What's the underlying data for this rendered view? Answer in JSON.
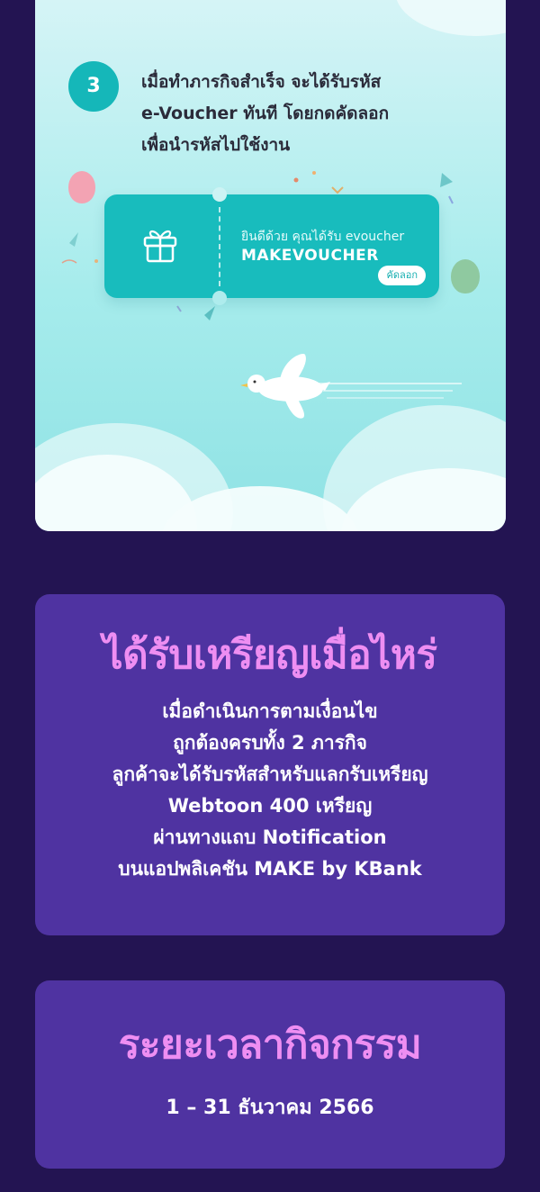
{
  "step": {
    "number": "3",
    "lines": [
      "เมื่อทำภารกิจสำเร็จ จะได้รับรหัส",
      "e-Voucher ทันที โดยกดคัดลอก",
      "เพื่อนำรหัสไปใช้งาน"
    ]
  },
  "voucher": {
    "message": "ยินดีด้วย คุณได้รับ evoucher",
    "code": "MAKEVOUCHER",
    "copy_label": "คัดลอก",
    "icon": "gift-icon"
  },
  "reward": {
    "title": "ได้รับเหรียญเมื่อไหร่",
    "lines": [
      "เมื่อดำเนินการตามเงื่อนไข",
      "ถูกต้องครบทั้ง 2 ภารกิจ",
      "ลูกค้าจะได้รับรหัสสำหรับแลกรับเหรียญ",
      "Webtoon 400 เหรียญ",
      "ผ่านทางแถบ Notification",
      "บนแอปพลิเคชัน MAKE by KBank"
    ]
  },
  "period": {
    "title": "ระยะเวลากิจกรรม",
    "date": "1 – 31 ธันวาคม 2566"
  },
  "colors": {
    "page_background": "#231452",
    "card_background": "#4f33a1",
    "title_accent": "#ee8ef2",
    "teal": "#18bcbd"
  }
}
